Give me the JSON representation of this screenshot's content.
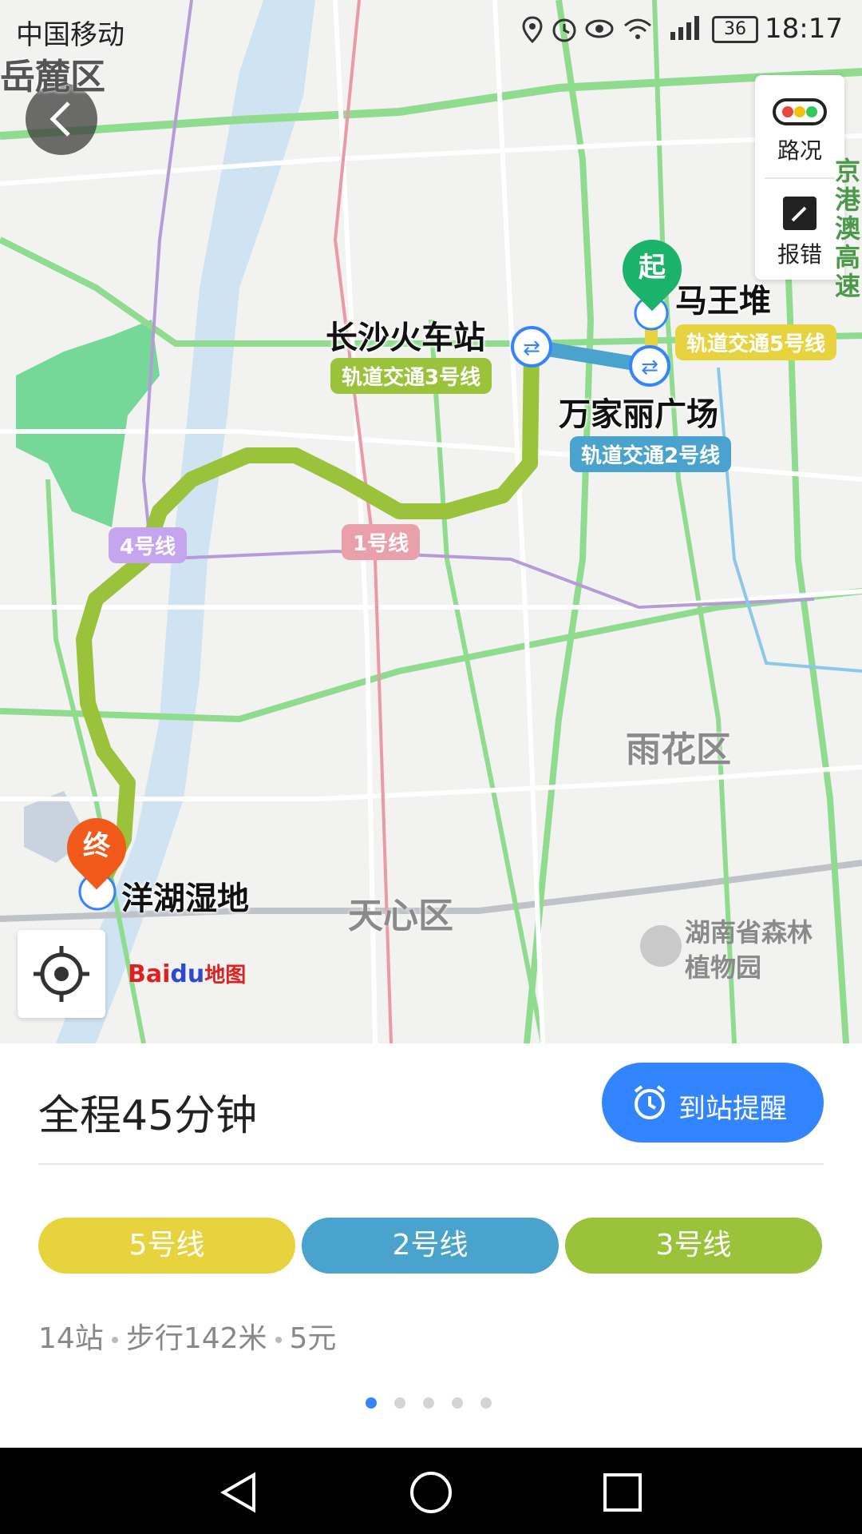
{
  "status_bar": {
    "carrier": "中国移动",
    "battery": "36",
    "time": "18:17",
    "icons": [
      "location-icon",
      "alarm-icon",
      "eye-icon",
      "wifi-icon",
      "4g-signal-icon"
    ]
  },
  "map": {
    "side_panel": {
      "traffic_label": "路况",
      "report_label": "报错"
    },
    "districts": [
      "岳麓区",
      "雨花区",
      "天心区"
    ],
    "expressway_label": "京港澳高速",
    "park_label_1": "湖南省森林",
    "park_label_2": "植物园",
    "start_marker": "起",
    "end_marker": "终",
    "stations": {
      "start": "马王堆",
      "transfer_1": "万家丽广场",
      "transfer_2": "长沙火车站",
      "end": "洋湖湿地"
    },
    "line_tags": {
      "line5": "轨道交通5号线",
      "line2": "轨道交通2号线",
      "line3": "轨道交通3号线",
      "line4": "4号线",
      "line1": "1号线"
    },
    "logo": {
      "bai": "Bai",
      "du": "du",
      "text": "地图"
    }
  },
  "panel": {
    "total_time": "全程45分钟",
    "remind_button": "到站提醒",
    "lines": [
      {
        "label": "5号线",
        "color": "#e7d33e"
      },
      {
        "label": "2号线",
        "color": "#4aa3cc"
      },
      {
        "label": "3号线",
        "color": "#9ac23a"
      }
    ],
    "summary": {
      "stops": "14站",
      "walk": "步行142米",
      "fare": "5元"
    },
    "pager": {
      "count": 5,
      "active": 1
    }
  },
  "colors": {
    "accent": "#3385ff",
    "route_green": "#9ac23a",
    "route_blue": "#4aa3cc",
    "route_yellow": "#e7d33e",
    "start_pin": "#1bb36b",
    "end_pin": "#f25a1b"
  }
}
